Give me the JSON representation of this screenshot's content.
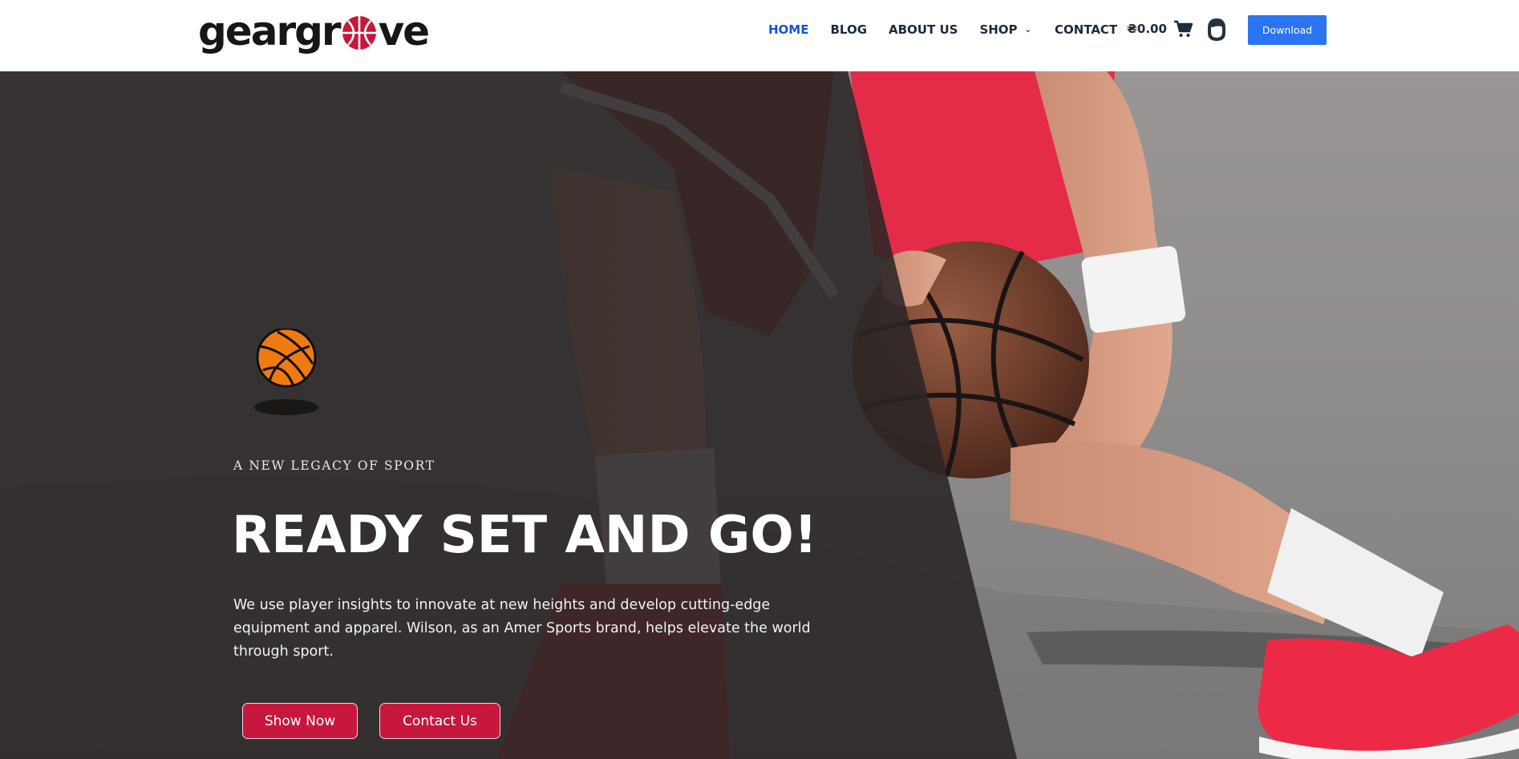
{
  "brand": {
    "logo_left": "geargr",
    "logo_right": "ve"
  },
  "nav": {
    "items": [
      {
        "label": "HOME",
        "active": true
      },
      {
        "label": "BLOG",
        "active": false
      },
      {
        "label": "ABOUT US",
        "active": false
      },
      {
        "label": "SHOP",
        "active": false,
        "has_dropdown": true
      },
      {
        "label": "CONTACT",
        "active": false
      }
    ],
    "cart_total": "₴0.00",
    "download_label": "Download"
  },
  "hero": {
    "eyebrow": "A NEW LEGACY OF SPORT",
    "headline": "READY SET AND GO!",
    "body": "We use player insights to innovate at new heights and develop cutting-edge equipment and apparel. Wilson, as an Amer Sports brand, helps elevate the world through sport.",
    "buttons": {
      "shop": "Show Now",
      "contact": "Contact Us"
    }
  },
  "colors": {
    "accent_blue": "#2b74f2",
    "nav_active": "#1553d4",
    "button_red": "#c8173d",
    "logo_red": "#c8173d",
    "overlay_dark": "#2a2626"
  },
  "icons": [
    "basketball-logo-icon",
    "chevron-down-icon",
    "cart-icon",
    "account-icon",
    "basketball-icon"
  ]
}
